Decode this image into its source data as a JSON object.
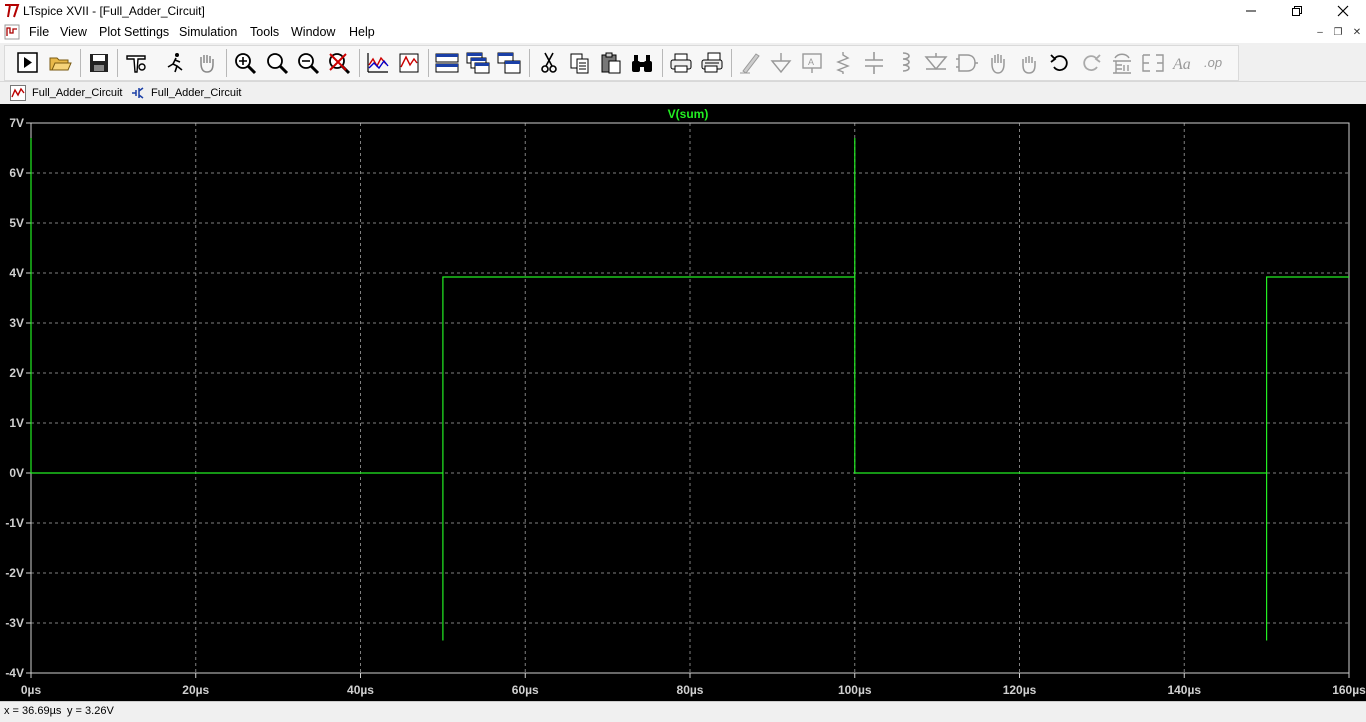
{
  "window": {
    "title": "LTspice XVII - [Full_Adder_Circuit]"
  },
  "menu": [
    "File",
    "View",
    "Plot Settings",
    "Simulation",
    "Tools",
    "Window",
    "Help"
  ],
  "toolbar": {
    "icons": [
      "run-icon",
      "open-icon",
      "save-icon",
      "control-panel-icon",
      "halt-icon",
      "pan-icon",
      "zoom-in-icon",
      "zoom-area-icon",
      "zoom-out-icon",
      "zoom-cancel-icon",
      "autorange-icon",
      "edit-trace-icon",
      "tile-horizontal-icon",
      "cascade-icon",
      "tile-vertical-icon",
      "cut-icon",
      "copy-icon",
      "paste-icon",
      "find-icon",
      "print-icon",
      "print-setup-icon",
      "wire-icon",
      "ground-icon",
      "label-net-icon",
      "resistor-icon",
      "capacitor-icon",
      "inductor-icon",
      "diode-icon",
      "component-icon",
      "move-icon",
      "drag-icon",
      "undo-icon",
      "redo-icon",
      "rotate-icon",
      "mirror-icon",
      "text-icon",
      "spice-directive-icon"
    ]
  },
  "tabs": [
    {
      "label": "Full_Adder_Circuit",
      "type": "waveform"
    },
    {
      "label": "Full_Adder_Circuit",
      "type": "schematic"
    }
  ],
  "colors": {
    "trace": "#22ee22",
    "grid": "#808080",
    "axis_text": "#d0d0d0",
    "plot_bg": "#000000"
  },
  "chart_data": {
    "type": "line",
    "title": "V(sum)",
    "xlabel": "",
    "ylabel": "",
    "x_unit": "µs",
    "y_unit": "V",
    "xlim": [
      0,
      160
    ],
    "ylim": [
      -4,
      7
    ],
    "x_ticks": [
      "0µs",
      "20µs",
      "40µs",
      "60µs",
      "80µs",
      "100µs",
      "120µs",
      "140µs",
      "160µs"
    ],
    "y_ticks": [
      "7V",
      "6V",
      "5V",
      "4V",
      "3V",
      "2V",
      "1V",
      "0V",
      "-1V",
      "-2V",
      "-3V",
      "-4V"
    ],
    "grid": true,
    "series": [
      {
        "name": "V(sum)",
        "x": [
          0,
          0,
          0,
          50,
          50,
          50,
          50,
          100,
          100,
          100,
          100,
          150,
          150,
          150,
          150,
          160
        ],
        "y": [
          0,
          6.7,
          0,
          0,
          -3.35,
          3.92,
          3.92,
          3.92,
          6.7,
          0,
          0,
          0,
          -3.35,
          3.92,
          3.92,
          3.92
        ]
      }
    ]
  },
  "status": {
    "cursor_x": "x = 36.69µs",
    "cursor_y": "y = 3.26V"
  }
}
